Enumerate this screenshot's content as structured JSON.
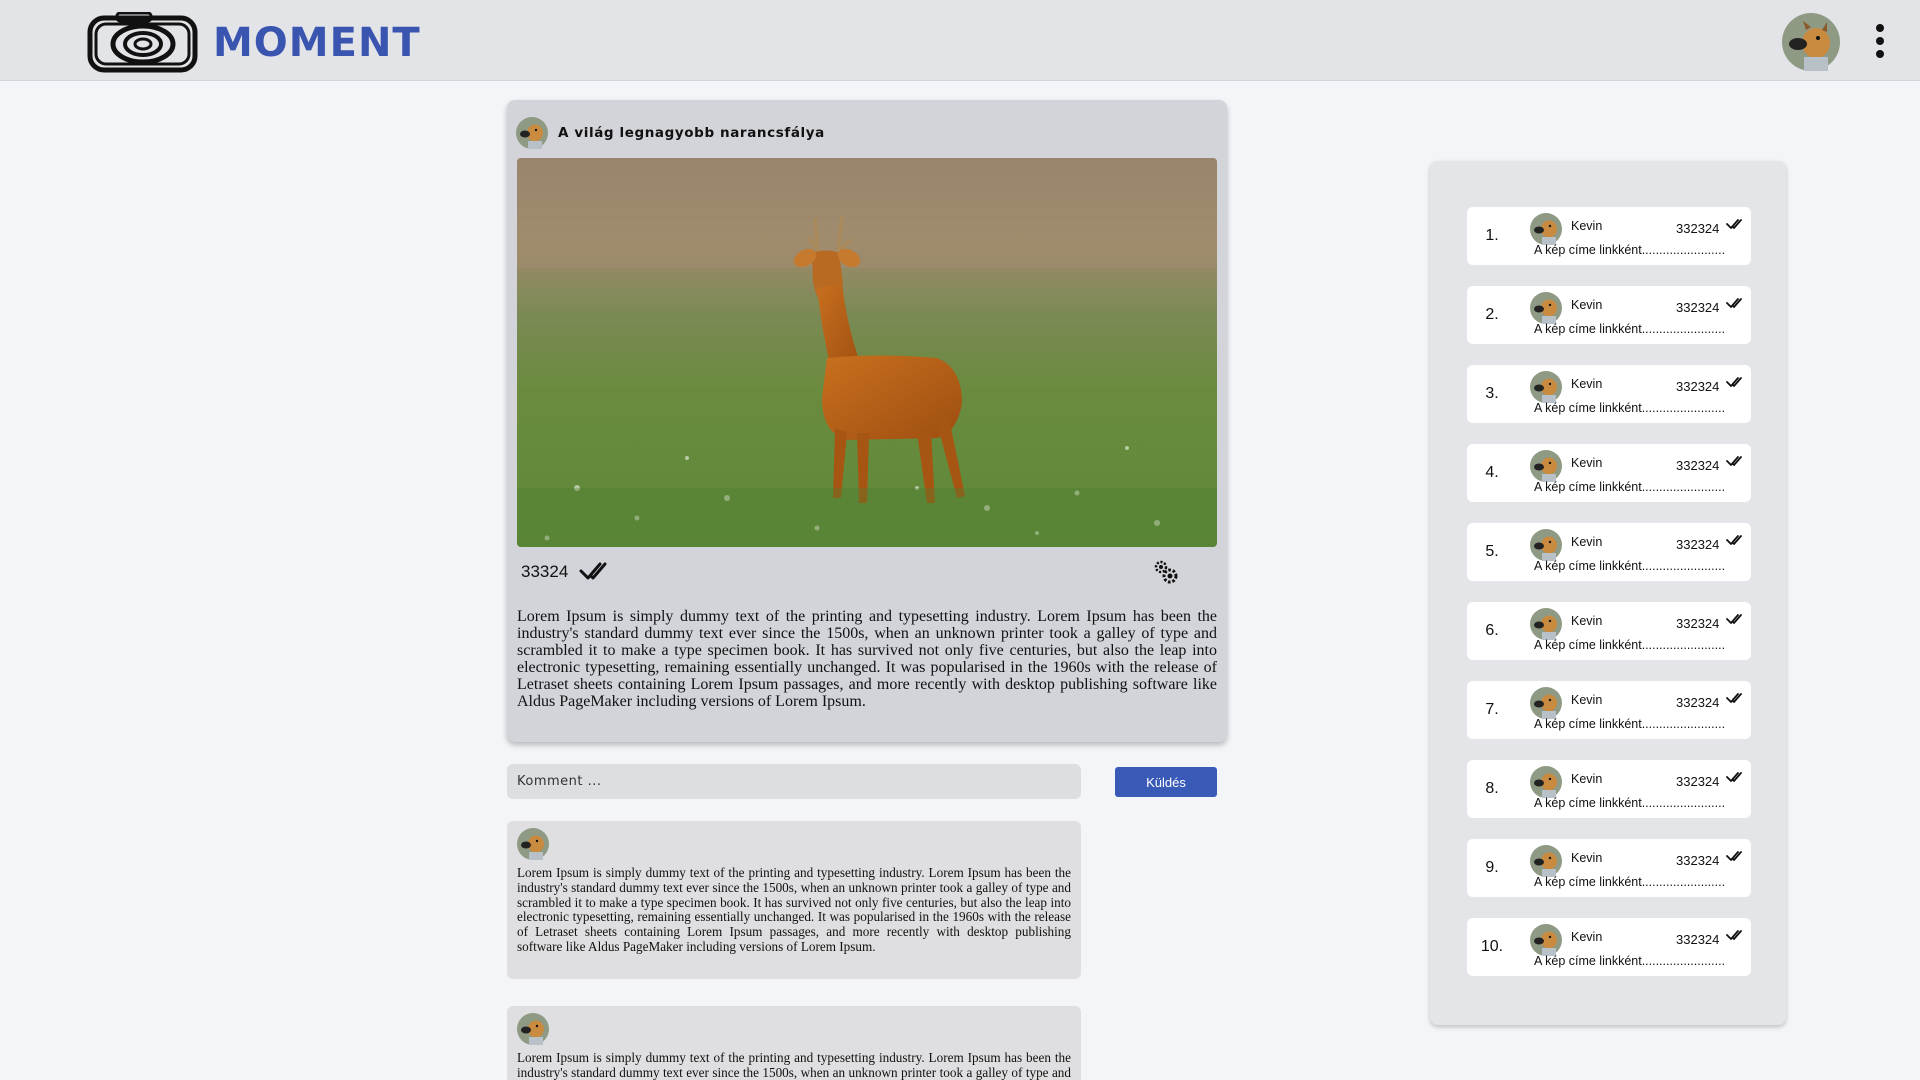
{
  "header": {
    "brand": "MOMENT"
  },
  "post": {
    "title": "A világ legnagyobb narancsfálya",
    "like_count": "33324",
    "body": "Lorem Ipsum is simply dummy text of the printing and typesetting industry. Lorem Ipsum has been the industry's standard dummy text ever since the 1500s, when an unknown printer took a galley of type and scrambled it to make a type specimen book. It has survived not only five centuries, but also the leap into electronic typesetting, remaining essentially unchanged. It was popularised in the 1960s with the release of Letraset sheets containing Lorem Ipsum passages, and more recently with desktop publishing software like Aldus PageMaker including versions of Lorem Ipsum."
  },
  "comment_form": {
    "placeholder": "Komment ...",
    "send_label": "Küldés"
  },
  "comments": [
    {
      "text": "Lorem Ipsum is simply dummy text of the printing and typesetting industry. Lorem Ipsum has been the industry's standard dummy text ever since the 1500s, when an unknown printer took a galley of type and scrambled it to make a type specimen book. It has survived not only five centuries, but also the leap into electronic typesetting, remaining essentially unchanged. It was popularised in the 1960s with the release of Letraset sheets containing Lorem Ipsum passages, and more recently with desktop publishing software like Aldus PageMaker including versions of Lorem Ipsum."
    },
    {
      "text": "Lorem Ipsum is simply dummy text of the printing and typesetting industry. Lorem Ipsum has been the industry's standard dummy text ever since the 1500s, when an unknown printer took a galley of type and scrambled it to make a type specimen book. It has survived not only five centuries, but also the leap into electronic typesetting, remaining essentially unchanged."
    }
  ],
  "leaderboard": [
    {
      "rank": "1.",
      "name": "Kevin",
      "count": "332324",
      "link": "A kép címe linkként........................"
    },
    {
      "rank": "2.",
      "name": "Kevin",
      "count": "332324",
      "link": "A kép címe linkként........................"
    },
    {
      "rank": "3.",
      "name": "Kevin",
      "count": "332324",
      "link": "A kép címe linkként........................"
    },
    {
      "rank": "4.",
      "name": "Kevin",
      "count": "332324",
      "link": "A kép címe linkként........................"
    },
    {
      "rank": "5.",
      "name": "Kevin",
      "count": "332324",
      "link": "A kép címe linkként........................"
    },
    {
      "rank": "6.",
      "name": "Kevin",
      "count": "332324",
      "link": "A kép címe linkként........................"
    },
    {
      "rank": "7.",
      "name": "Kevin",
      "count": "332324",
      "link": "A kép címe linkként........................"
    },
    {
      "rank": "8.",
      "name": "Kevin",
      "count": "332324",
      "link": "A kép címe linkként........................"
    },
    {
      "rank": "9.",
      "name": "Kevin",
      "count": "332324",
      "link": "A kép címe linkként........................"
    },
    {
      "rank": "10.",
      "name": "Kevin",
      "count": "332324",
      "link": "A kép címe linkként........................"
    }
  ],
  "icons": {
    "logo": "camera-rings-logo",
    "avatar": "dog-avatar-icon",
    "menu": "kebab-menu-icon",
    "like": "double-check-icon",
    "settings": "gears-icon"
  },
  "colors": {
    "brand": "#3a55b0",
    "send_button": "#3a5ab8",
    "header_bg": "#e3e4e8",
    "card_bg": "#d2d4da"
  }
}
